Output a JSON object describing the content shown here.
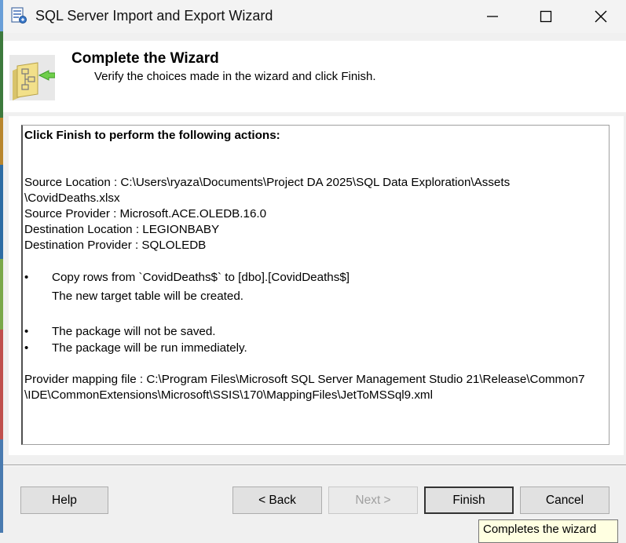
{
  "window": {
    "title": "SQL Server Import and Export Wizard"
  },
  "header": {
    "title": "Complete the Wizard",
    "subtitle": "Verify the choices made in the wizard and click Finish."
  },
  "summary": {
    "heading": "Click Finish to perform the following actions:",
    "source_location_line1": "Source Location : C:\\Users\\ryaza\\Documents\\Project DA 2025\\SQL Data Exploration\\Assets",
    "source_location_line2": "\\CovidDeaths.xlsx",
    "source_provider": "Source Provider : Microsoft.ACE.OLEDB.16.0",
    "destination_location": "Destination Location : LEGIONBABY",
    "destination_provider": "Destination Provider : SQLOLEDB",
    "bullet_symbol": "•",
    "copy_rows": "Copy rows from `CovidDeaths$` to [dbo].[CovidDeaths$]",
    "copy_rows_note": "The new target table will be created.",
    "not_saved": "The package will not be saved.",
    "run_immediately": "The package will be run immediately.",
    "mapping_line1": "Provider mapping file : C:\\Program Files\\Microsoft SQL Server Management Studio 21\\Release\\Common7",
    "mapping_line2": "\\IDE\\CommonExtensions\\Microsoft\\SSIS\\170\\MappingFiles\\JetToMSSql9.xml"
  },
  "buttons": {
    "help": "Help",
    "back": "< Back",
    "next": "Next >",
    "finish": "Finish",
    "cancel": "Cancel"
  },
  "tooltip": {
    "text": "Completes the wizard"
  },
  "icons": {
    "app": "wizard-app-icon",
    "header": "folder-arrow-icon",
    "minimize": "minimize-icon",
    "maximize": "maximize-icon",
    "close": "close-icon"
  }
}
